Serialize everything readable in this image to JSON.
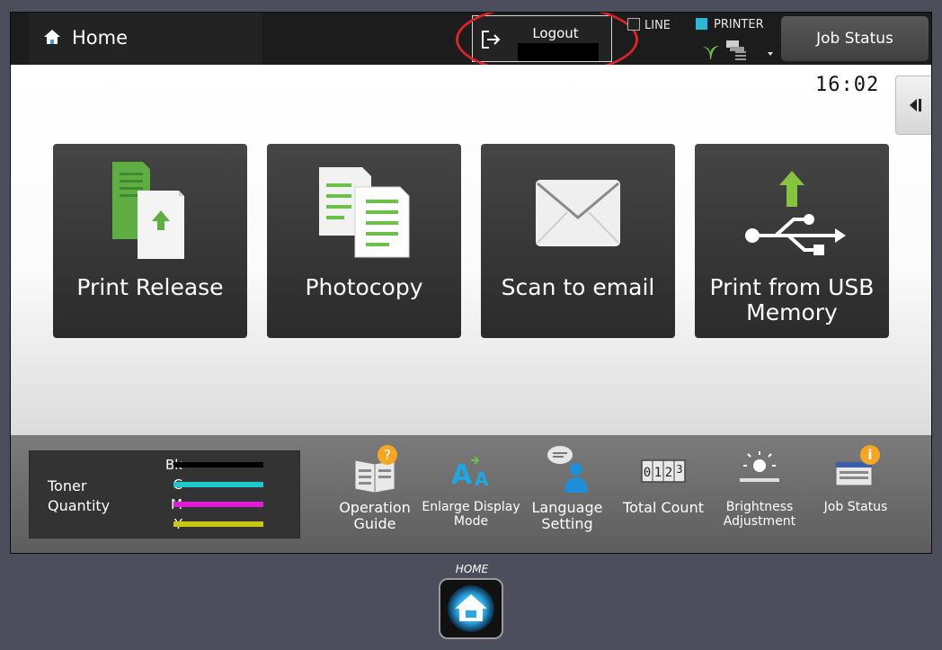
{
  "header": {
    "home_label": "Home",
    "logout_label": "Logout",
    "line_label": "LINE",
    "printer_label": "PRINTER",
    "job_status_label": "Job Status"
  },
  "main": {
    "clock": "16:02",
    "tiles": [
      {
        "label": "Print Release",
        "icon": "print-release-icon"
      },
      {
        "label": "Photocopy",
        "icon": "photocopy-icon"
      },
      {
        "label": "Scan to email",
        "icon": "envelope-icon"
      },
      {
        "label": "Print from USB Memory",
        "icon": "usb-icon"
      }
    ]
  },
  "toner": {
    "title": "Toner Quantity",
    "rows": [
      {
        "label": "Bk",
        "color": "#000000",
        "level": 1.0
      },
      {
        "label": "C",
        "color": "#1fc7cf",
        "level": 1.0
      },
      {
        "label": "M",
        "color": "#e21bd9",
        "level": 1.0
      },
      {
        "label": "Y",
        "color": "#c8c812",
        "level": 1.0
      }
    ]
  },
  "tools": [
    {
      "label": "Operation Guide",
      "icon": "operation-guide-icon"
    },
    {
      "label": "Enlarge Display Mode",
      "icon": "enlarge-display-icon"
    },
    {
      "label": "Language Setting",
      "icon": "language-setting-icon"
    },
    {
      "label": "Total Count",
      "icon": "total-count-icon",
      "counter": "0123"
    },
    {
      "label": "Brightness Adjustment",
      "icon": "brightness-icon"
    },
    {
      "label": "Job Status",
      "icon": "job-status-icon"
    }
  ],
  "physical_home_label": "HOME",
  "colors": {
    "accent_green": "#6cc04a",
    "printer_indicator": "#2bb7d8",
    "callout_red": "#d9252a"
  }
}
